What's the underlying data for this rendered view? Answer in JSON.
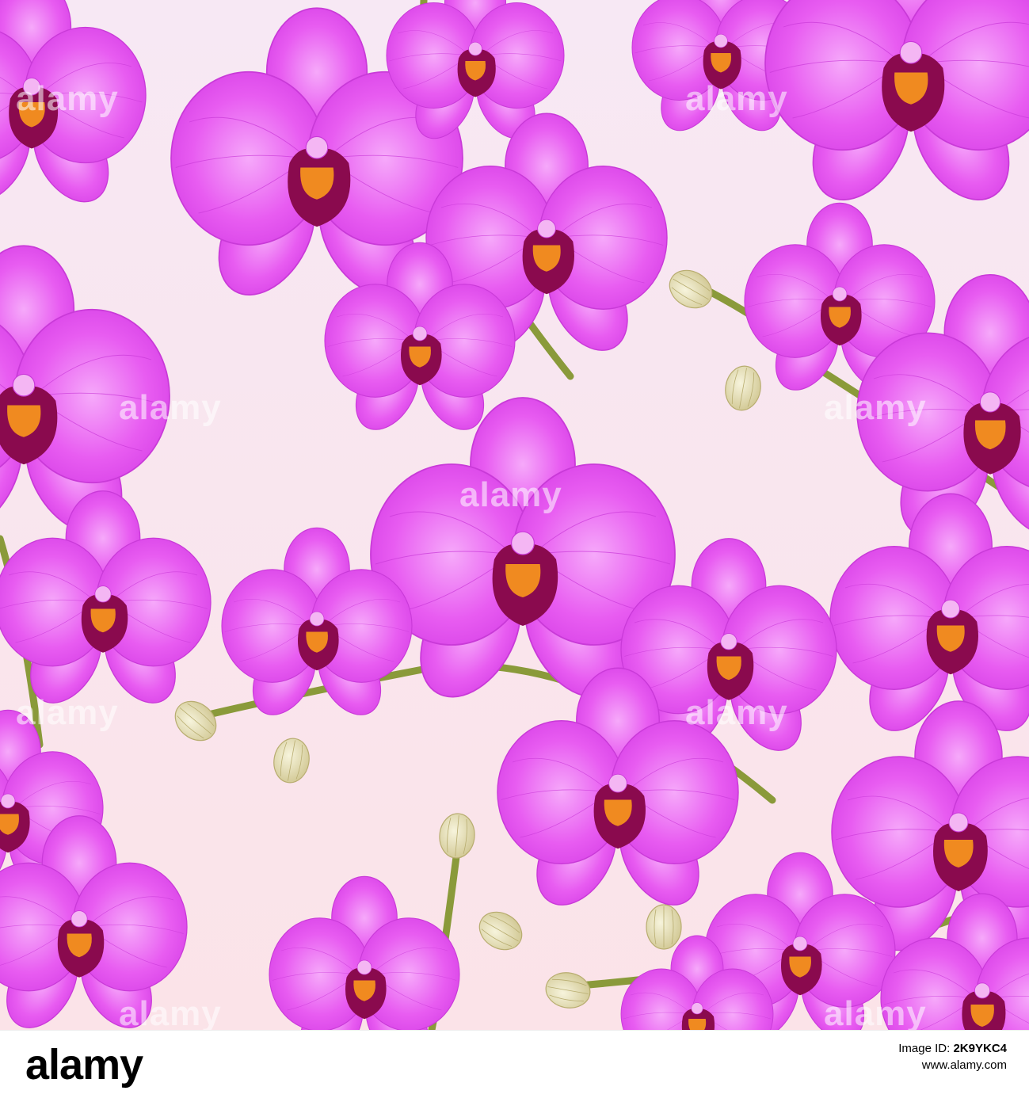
{
  "image": {
    "subject": "Seamless pattern of purple phalaenopsis orchids with buds on a light pink background",
    "colors": {
      "background_top": "#f7e8f4",
      "background_bottom": "#fbe3e8",
      "petal": "#e35cf0",
      "petal_light": "#f29cf7",
      "petal_outline": "#c93ad8",
      "lip": "#8a0a4e",
      "column": "#f08a20",
      "stem": "#8a9a3a",
      "bud": "#e7e1b8"
    }
  },
  "watermark": {
    "text": "alamy"
  },
  "footer": {
    "logo": "alamy",
    "image_id_label": "Image ID:",
    "image_id": "2K9YKC4",
    "url": "www.alamy.com"
  }
}
